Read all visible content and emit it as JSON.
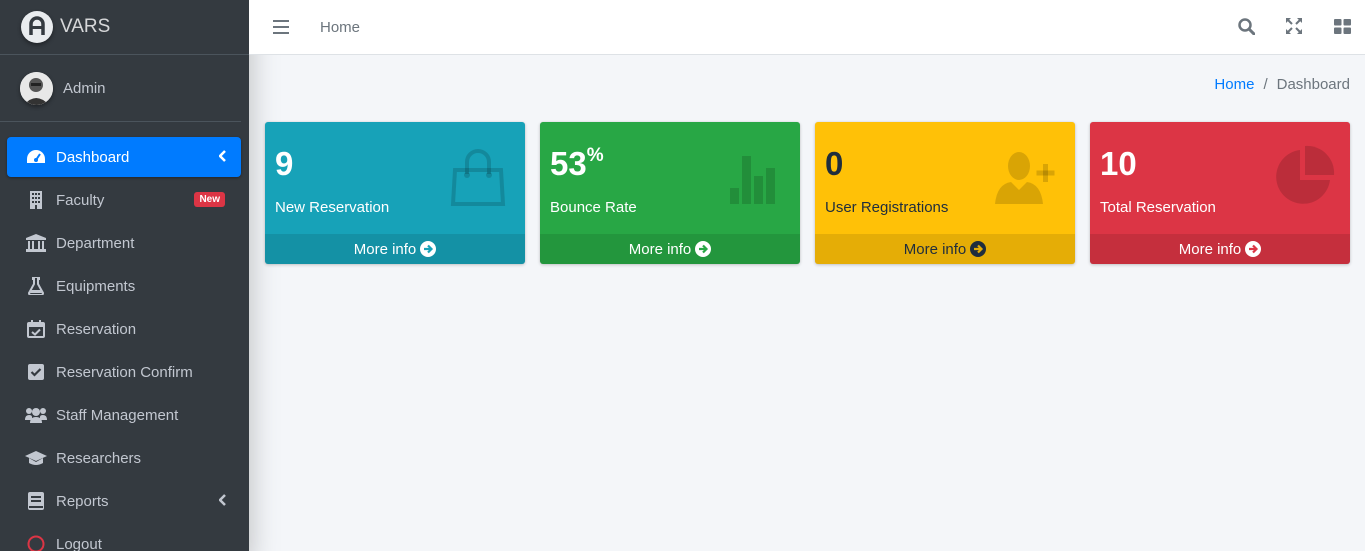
{
  "brand": {
    "name": "VARS"
  },
  "user": {
    "name": "Admin"
  },
  "sidebar": {
    "items": [
      {
        "label": "Dashboard",
        "icon": "tachometer-icon",
        "active": true
      },
      {
        "label": "Faculty",
        "icon": "building-icon",
        "badge": "New"
      },
      {
        "label": "Department",
        "icon": "university-icon"
      },
      {
        "label": "Equipments",
        "icon": "flask-icon"
      },
      {
        "label": "Reservation",
        "icon": "calendar-check-icon"
      },
      {
        "label": "Reservation Confirm",
        "icon": "check-square-icon"
      },
      {
        "label": "Staff Management",
        "icon": "users-icon"
      },
      {
        "label": "Researchers",
        "icon": "graduation-cap-icon"
      },
      {
        "label": "Reports",
        "icon": "book-icon"
      },
      {
        "label": "Logout",
        "icon": "circle-icon"
      }
    ]
  },
  "navbar": {
    "home_label": "Home"
  },
  "breadcrumb": {
    "home": "Home",
    "separator": "/",
    "current": "Dashboard"
  },
  "boxes": [
    {
      "value": "9",
      "suffix": "",
      "label": "New Reservation",
      "footer": "More info",
      "color": "#17a2b8",
      "icon": "shopping-bag-icon"
    },
    {
      "value": "53",
      "suffix": "%",
      "label": "Bounce Rate",
      "footer": "More info",
      "color": "#28a745",
      "icon": "bar-chart-icon"
    },
    {
      "value": "0",
      "suffix": "",
      "label": "User Registrations",
      "footer": "More info",
      "color": "#ffc107",
      "icon": "user-plus-icon"
    },
    {
      "value": "10",
      "suffix": "",
      "label": "Total Reservation",
      "footer": "More info",
      "color": "#dc3545",
      "icon": "pie-chart-icon"
    }
  ]
}
